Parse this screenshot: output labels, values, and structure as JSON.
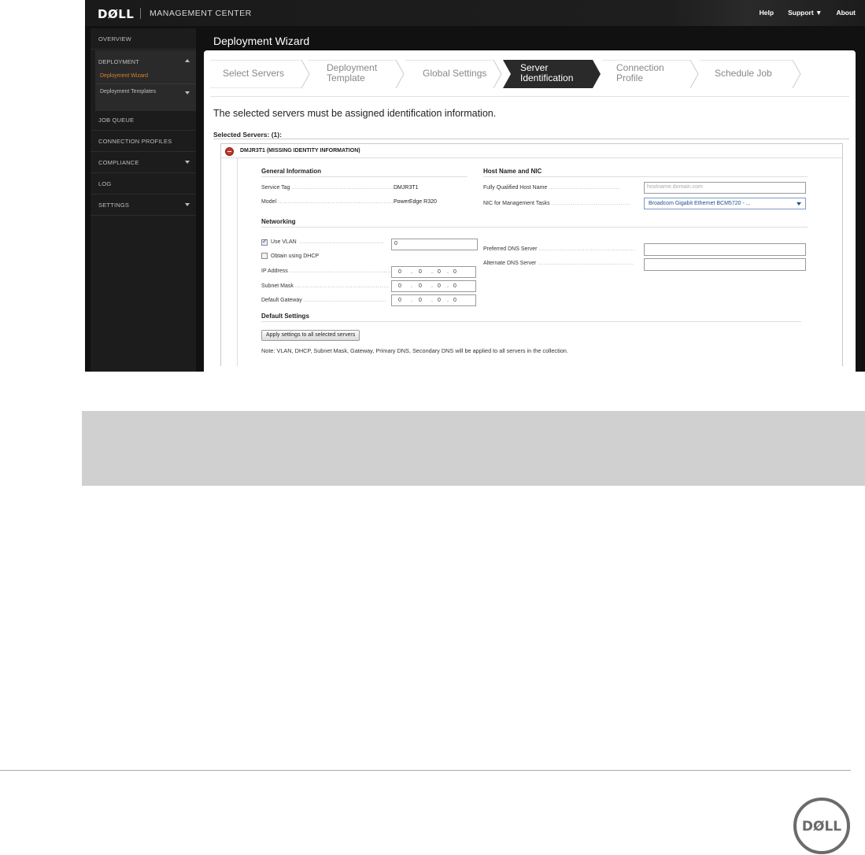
{
  "topbar": {
    "brand": "DØLL",
    "app_title": "MANAGEMENT CENTER",
    "links": [
      "Help",
      "Support ▼",
      "About"
    ]
  },
  "sidebar": {
    "overview": "OVERVIEW",
    "deployment": "DEPLOYMENT",
    "deployment_wizard": "Deployment Wizard",
    "deployment_templates": "Deployment Templates",
    "job_queue": "JOB QUEUE",
    "connection_profiles": "CONNECTION PROFILES",
    "compliance": "COMPLIANCE",
    "log": "LOG",
    "settings": "SETTINGS",
    "active_color": "#d9822b"
  },
  "page": {
    "title": "Deployment Wizard",
    "steps": [
      {
        "line1": "Select Servers",
        "line2": ""
      },
      {
        "line1": "Deployment",
        "line2": "Template"
      },
      {
        "line1": "Global Settings",
        "line2": ""
      },
      {
        "line1": "Server",
        "line2": "Identification"
      },
      {
        "line1": "Connection",
        "line2": "Profile"
      },
      {
        "line1": "Schedule Job",
        "line2": ""
      }
    ],
    "active_step": 3,
    "intro": "The selected servers must be assigned identification information.",
    "selected_label": "Selected Servers: (1):",
    "server_title": "DMJR3T1 (MISSING IDENTITY INFORMATION)"
  },
  "general": {
    "heading": "General Information",
    "service_tag_label": "Service Tag",
    "service_tag_value": "DMJR3T1",
    "model_label": "Model",
    "model_value": "PowerEdge R320"
  },
  "host": {
    "heading": "Host Name and NIC",
    "fqhn_label": "Fully Qualified Host Name",
    "fqhn_placeholder": "hostname.domain.com",
    "nic_label": "NIC for Management Tasks",
    "nic_value": "Broadcom Gigabit Ethernet BCM5720 - ..."
  },
  "networking": {
    "heading": "Networking",
    "use_vlan_label": "Use VLAN",
    "use_vlan_checked": true,
    "vlan_value": "0",
    "dhcp_label": "Obtain using DHCP",
    "dhcp_checked": false,
    "ip_label": "IP Address",
    "subnet_label": "Subnet Mask",
    "gateway_label": "Default Gateway",
    "octet": "0",
    "preferred_dns_label": "Preferred DNS Server",
    "alternate_dns_label": "Alternate DNS Server"
  },
  "defaults": {
    "heading": "Default Settings",
    "apply_button": "Apply settings to all selected servers",
    "note": "Note: VLAN, DHCP, Subnet Mask, Gateway, Primary DNS, Secondary DNS will be applied to all servers in the collection."
  },
  "footer": {
    "logo_text": "DØLL"
  }
}
